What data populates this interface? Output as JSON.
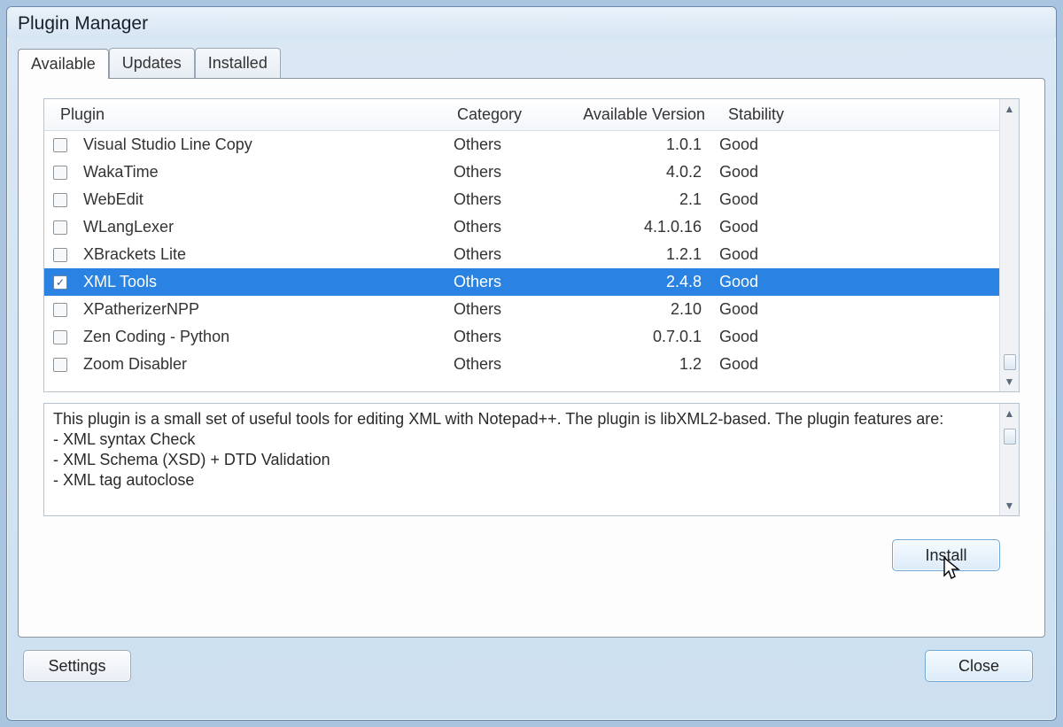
{
  "window": {
    "title": "Plugin Manager"
  },
  "tabs": {
    "available": "Available",
    "updates": "Updates",
    "installed": "Installed",
    "active_index": 0
  },
  "columns": {
    "plugin": "Plugin",
    "category": "Category",
    "version": "Available Version",
    "stability": "Stability"
  },
  "plugins": [
    {
      "name": "Visual Studio Line Copy",
      "category": "Others",
      "version": "1.0.1",
      "stability": "Good",
      "checked": false,
      "selected": false
    },
    {
      "name": "WakaTime",
      "category": "Others",
      "version": "4.0.2",
      "stability": "Good",
      "checked": false,
      "selected": false
    },
    {
      "name": "WebEdit",
      "category": "Others",
      "version": "2.1",
      "stability": "Good",
      "checked": false,
      "selected": false
    },
    {
      "name": "WLangLexer",
      "category": "Others",
      "version": "4.1.0.16",
      "stability": "Good",
      "checked": false,
      "selected": false
    },
    {
      "name": "XBrackets Lite",
      "category": "Others",
      "version": "1.2.1",
      "stability": "Good",
      "checked": false,
      "selected": false
    },
    {
      "name": "XML Tools",
      "category": "Others",
      "version": "2.4.8",
      "stability": "Good",
      "checked": true,
      "selected": true
    },
    {
      "name": "XPatherizerNPP",
      "category": "Others",
      "version": "2.10",
      "stability": "Good",
      "checked": false,
      "selected": false
    },
    {
      "name": "Zen Coding - Python",
      "category": "Others",
      "version": "0.7.0.1",
      "stability": "Good",
      "checked": false,
      "selected": false
    },
    {
      "name": "Zoom Disabler",
      "category": "Others",
      "version": "1.2",
      "stability": "Good",
      "checked": false,
      "selected": false
    }
  ],
  "description": "This plugin is a small set of useful tools for editing XML with Notepad++. The plugin is libXML2-based. The plugin features are:\n- XML syntax Check\n- XML Schema (XSD) + DTD Validation\n- XML tag autoclose",
  "buttons": {
    "install": "Install",
    "settings": "Settings",
    "close": "Close"
  }
}
